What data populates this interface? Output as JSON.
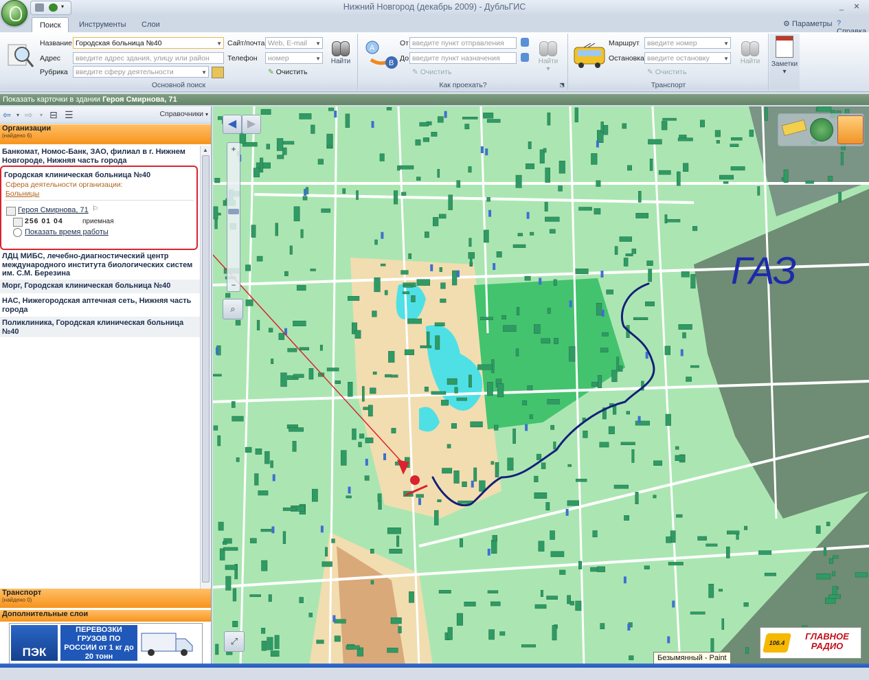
{
  "window": {
    "title": "Нижний Новгород (декабрь 2009)  -  ДубльГИС"
  },
  "tabs": [
    "Поиск",
    "Инструменты",
    "Слои"
  ],
  "tabs_right": {
    "params": "Параметры",
    "help": "Справка"
  },
  "search": {
    "name_label": "Название",
    "name_value": "Городская больница №40",
    "address_label": "Адрес",
    "address_placeholder": "введите адрес здания, улицу или район",
    "rubric_label": "Рубрика",
    "rubric_placeholder": "введите сферу деятельности",
    "site_label": "Сайт/почта",
    "site_placeholder": "Web, E-mail",
    "phone_label": "Телефон",
    "phone_placeholder": "номер",
    "find": "Найти",
    "clear": "Очистить",
    "group": "Основной поиск"
  },
  "route": {
    "from_label": "От",
    "from_placeholder": "введите пункт отправления",
    "to_label": "До",
    "to_placeholder": "введите пункт назначения",
    "find": "Найти",
    "clear": "Очистить",
    "group": "Как проехать?"
  },
  "transport": {
    "route_label": "Маршрут",
    "route_placeholder": "введите номер",
    "stop_label": "Остановка",
    "stop_placeholder": "введите остановку",
    "find": "Найти",
    "clear": "Очистить",
    "group": "Транспорт"
  },
  "notes": {
    "label": "Заметки"
  },
  "infobar": {
    "prefix": "Показать карточки в здании",
    "building": "Героя Смирнова, 71"
  },
  "panel": {
    "directories": "Справочники",
    "org_head": "Организации",
    "org_count": "(найдено 6)",
    "items": [
      "Банкомат, Номос-Банк, ЗАО, филиал в г. Нижнем Новгороде, Нижняя часть города",
      "ЛДЦ МИБС, лечебно-диагностический центр международного института биологических систем им. С.М. Березина",
      "Морг, Городская клиническая больница №40",
      "НАС, Нижегородская аптечная сеть, Нижняя часть города",
      "Поликлиника, Городская клиническая больница №40"
    ],
    "selected": {
      "name": "Городская клиническая больница №40",
      "sphere_label": "Сфера деятельности организации:",
      "rubric": "Больницы",
      "address": "Героя Смирнова, 71",
      "phone": "256  01  04",
      "phone_note": "приемная",
      "hours": "Показать время работы"
    },
    "transport_head": "Транспорт",
    "transport_count": "(найдено 0)",
    "layers_head": "Дополнительные слои"
  },
  "ad": {
    "logo": "ПЭК",
    "text": "ПЕРЕВОЗКИ ГРУЗОВ ПО РОССИИ от 1 кг до 20 тонн"
  },
  "map": {
    "annotation": "ГАЗ"
  },
  "radio": {
    "freq": "106.4",
    "name": "ГЛАВНОЕ РАДИО"
  },
  "taskbar_tip": "Безымянный - Paint",
  "colors": {
    "map_green": "#a9e6b0",
    "building": "#2f9a64",
    "orange": "#f7941d",
    "route": "#13207a",
    "arrow": "#d9232e"
  }
}
